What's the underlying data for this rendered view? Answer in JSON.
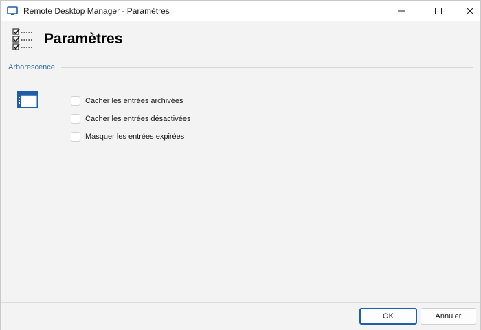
{
  "window": {
    "title": "Remote Desktop Manager - Paramètres",
    "controls": {
      "minimize": "minimize-icon",
      "maximize": "maximize-icon",
      "close": "close-icon"
    }
  },
  "header": {
    "title": "Paramètres",
    "icon": "settings-checklist-icon"
  },
  "group": {
    "title": "Arborescence",
    "icon": "tree-view-icon"
  },
  "options": [
    {
      "label": "Cacher les entrées archivées",
      "checked": false
    },
    {
      "label": "Cacher les entrées désactivées",
      "checked": false
    },
    {
      "label": "Masquer les entrées expirées",
      "checked": false
    }
  ],
  "footer": {
    "ok_label": "OK",
    "cancel_label": "Annuler"
  },
  "colors": {
    "accent": "#2b6cb0",
    "default_button_border": "#1f5fa8"
  }
}
